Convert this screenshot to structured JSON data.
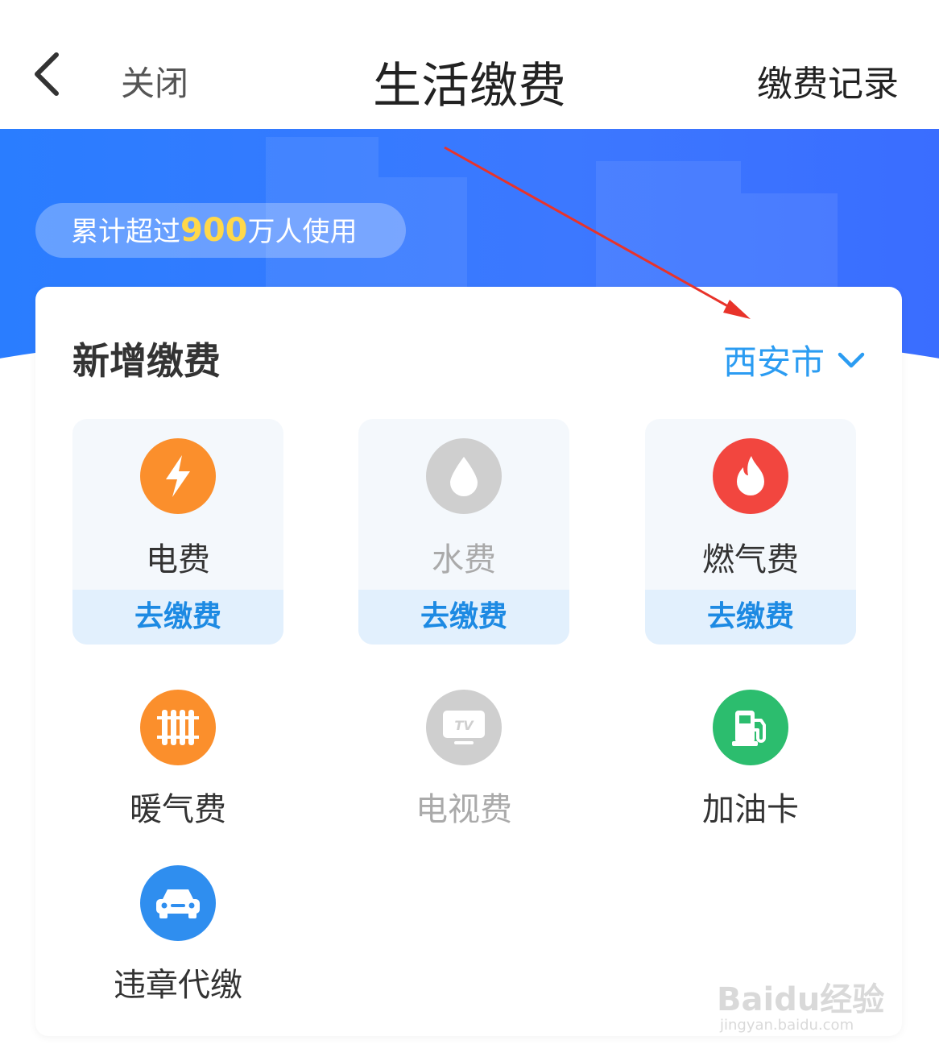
{
  "header": {
    "back_icon": "chevron-left-icon",
    "close_label": "关闭",
    "title": "生活缴费",
    "record_label": "缴费记录"
  },
  "hero": {
    "badge_prefix": "累计超过",
    "badge_number": "900",
    "badge_suffix": "万人使用",
    "bg_color": "#3a7bff",
    "number_color": "#ffd84a"
  },
  "card": {
    "title": "新增缴费",
    "city": "西安市",
    "city_color": "#2b9cf2"
  },
  "tiles": [
    {
      "label": "电费",
      "pay_label": "去缴费",
      "icon": "lightning-icon",
      "color": "#fb8f2c",
      "enabled": true
    },
    {
      "label": "水费",
      "pay_label": "去缴费",
      "icon": "water-drop-icon",
      "color": "#cfcfcf",
      "enabled": false
    },
    {
      "label": "燃气费",
      "pay_label": "去缴费",
      "icon": "flame-icon",
      "color": "#f2463f",
      "enabled": true
    }
  ],
  "items": [
    {
      "label": "暖气费",
      "icon": "radiator-icon",
      "color": "#fb8f2c",
      "enabled": true
    },
    {
      "label": "电视费",
      "icon": "tv-icon",
      "icon_text": "TV",
      "color": "#cfcfcf",
      "enabled": false
    },
    {
      "label": "加油卡",
      "icon": "fuel-pump-icon",
      "color": "#2cbd6e",
      "enabled": true
    },
    {
      "label": "违章代缴",
      "icon": "car-icon",
      "color": "#2f8eef",
      "enabled": true
    }
  ],
  "watermark": {
    "brand": "Baidu经验",
    "url": "jingyan.baidu.com"
  }
}
